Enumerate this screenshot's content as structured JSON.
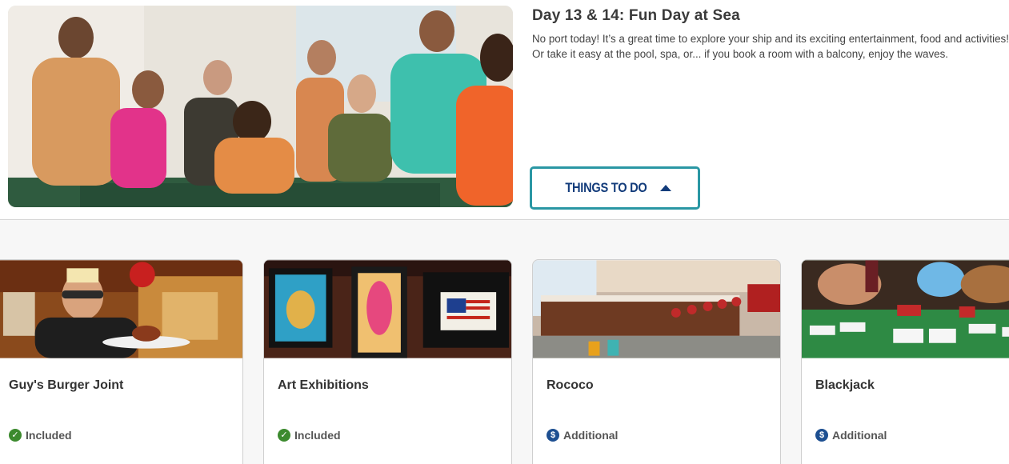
{
  "day": {
    "title": "Day 13 & 14: Fun Day at Sea",
    "description": "No port today! It’s a great time to explore your ship and its exciting entertainment, food and activities! Or take it easy at the pool, spa, or... if you book a room with a balcony, enjoy the waves.",
    "things_button": "THINGS TO DO",
    "things_icon": "caret-up-icon"
  },
  "activities": [
    {
      "title": "Guy's Burger Joint",
      "badge": "Included",
      "badge_icon": "check-circle-icon",
      "badge_color": "#3c8a2e"
    },
    {
      "title": "Art Exhibitions",
      "badge": "Included",
      "badge_icon": "check-circle-icon",
      "badge_color": "#3c8a2e"
    },
    {
      "title": "Rococo",
      "badge": "Additional",
      "badge_icon": "dollar-circle-icon",
      "badge_color": "#1d4f91"
    },
    {
      "title": "Blackjack",
      "badge": "Additional",
      "badge_icon": "dollar-circle-icon",
      "badge_color": "#1d4f91"
    }
  ],
  "colors": {
    "accent_border": "#2a97a4",
    "button_text": "#133c7b"
  }
}
